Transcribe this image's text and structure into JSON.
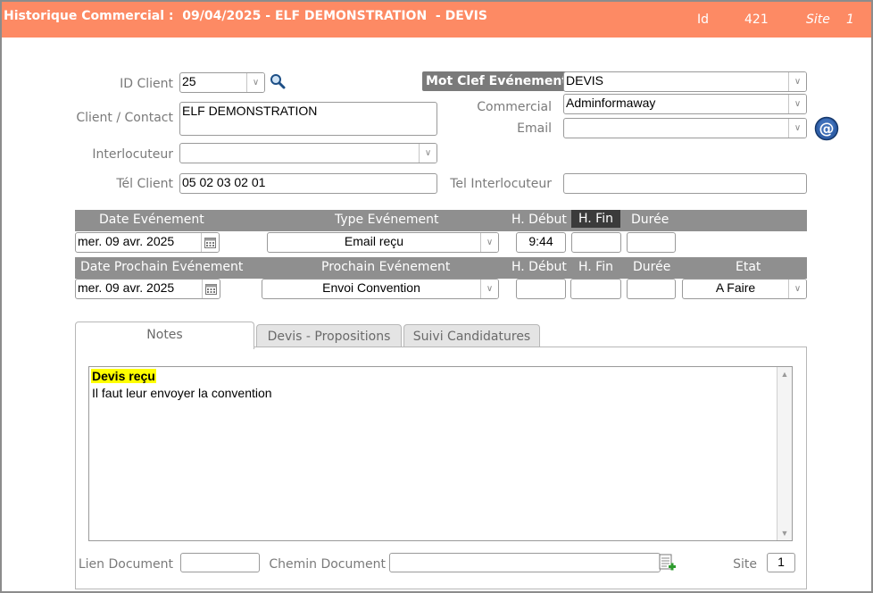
{
  "header": {
    "title": "Historique Commercial :  09/04/2025 - ELF DEMONSTRATION  - DEVIS",
    "id_label": "Id",
    "id_value": "421",
    "site_label": "Site",
    "site_value": "1"
  },
  "client": {
    "id_label": "ID Client",
    "id_value": "25",
    "contact_label": "Client / Contact",
    "contact_value": "ELF DEMONSTRATION",
    "interlocuteur_label": "Interlocuteur",
    "interlocuteur_value": "",
    "tel_label": "Tél Client",
    "tel_value": "05 02 03 02 01"
  },
  "right": {
    "mot_clef_label": "Mot Clef Evénement",
    "mot_clef_value": "DEVIS",
    "commercial_label": "Commercial",
    "commercial_value": "Adminformaway",
    "email_label": "Email",
    "email_value": "",
    "tel_interlocuteur_label": "Tel Interlocuteur",
    "tel_interlocuteur_value": ""
  },
  "event": {
    "headers": {
      "date": "Date Evénement",
      "type": "Type Evénement",
      "h_debut": "H. Début",
      "h_fin": "H. Fin",
      "duree": "Durée"
    },
    "date_value": "mer. 09 avr. 2025",
    "type_value": "Email reçu",
    "h_debut_value": "9:44",
    "h_fin_value": "",
    "duree_value": ""
  },
  "next_event": {
    "headers": {
      "date": "Date Prochain Evénement",
      "type": "Prochain Evénement",
      "h_debut": "H. Début",
      "h_fin": "H. Fin",
      "duree": "Durée",
      "etat": "Etat"
    },
    "date_value": "mer. 09 avr. 2025",
    "type_value": "Envoi Convention",
    "h_debut_value": "",
    "h_fin_value": "",
    "duree_value": "",
    "etat_value": "A Faire"
  },
  "tabs": [
    {
      "label": "Notes"
    },
    {
      "label": "Devis - Propositions"
    },
    {
      "label": "Suivi Candidatures"
    }
  ],
  "notes": {
    "highlight": "Devis reçu",
    "line2": "Il faut leur envoyer la convention"
  },
  "footer": {
    "lien_label": "Lien Document",
    "lien_value": "",
    "chemin_label": "Chemin Document",
    "chemin_value": "",
    "site_label": "Site",
    "site_value": "1"
  },
  "colors": {
    "titlebar": "#fd8a64",
    "header_bar": "#8f8f8f",
    "highlight": "#ffff00"
  },
  "icons": [
    "dropdown-arrow-icon",
    "search-icon",
    "email-at-icon",
    "calendar-icon",
    "add-document-icon"
  ]
}
